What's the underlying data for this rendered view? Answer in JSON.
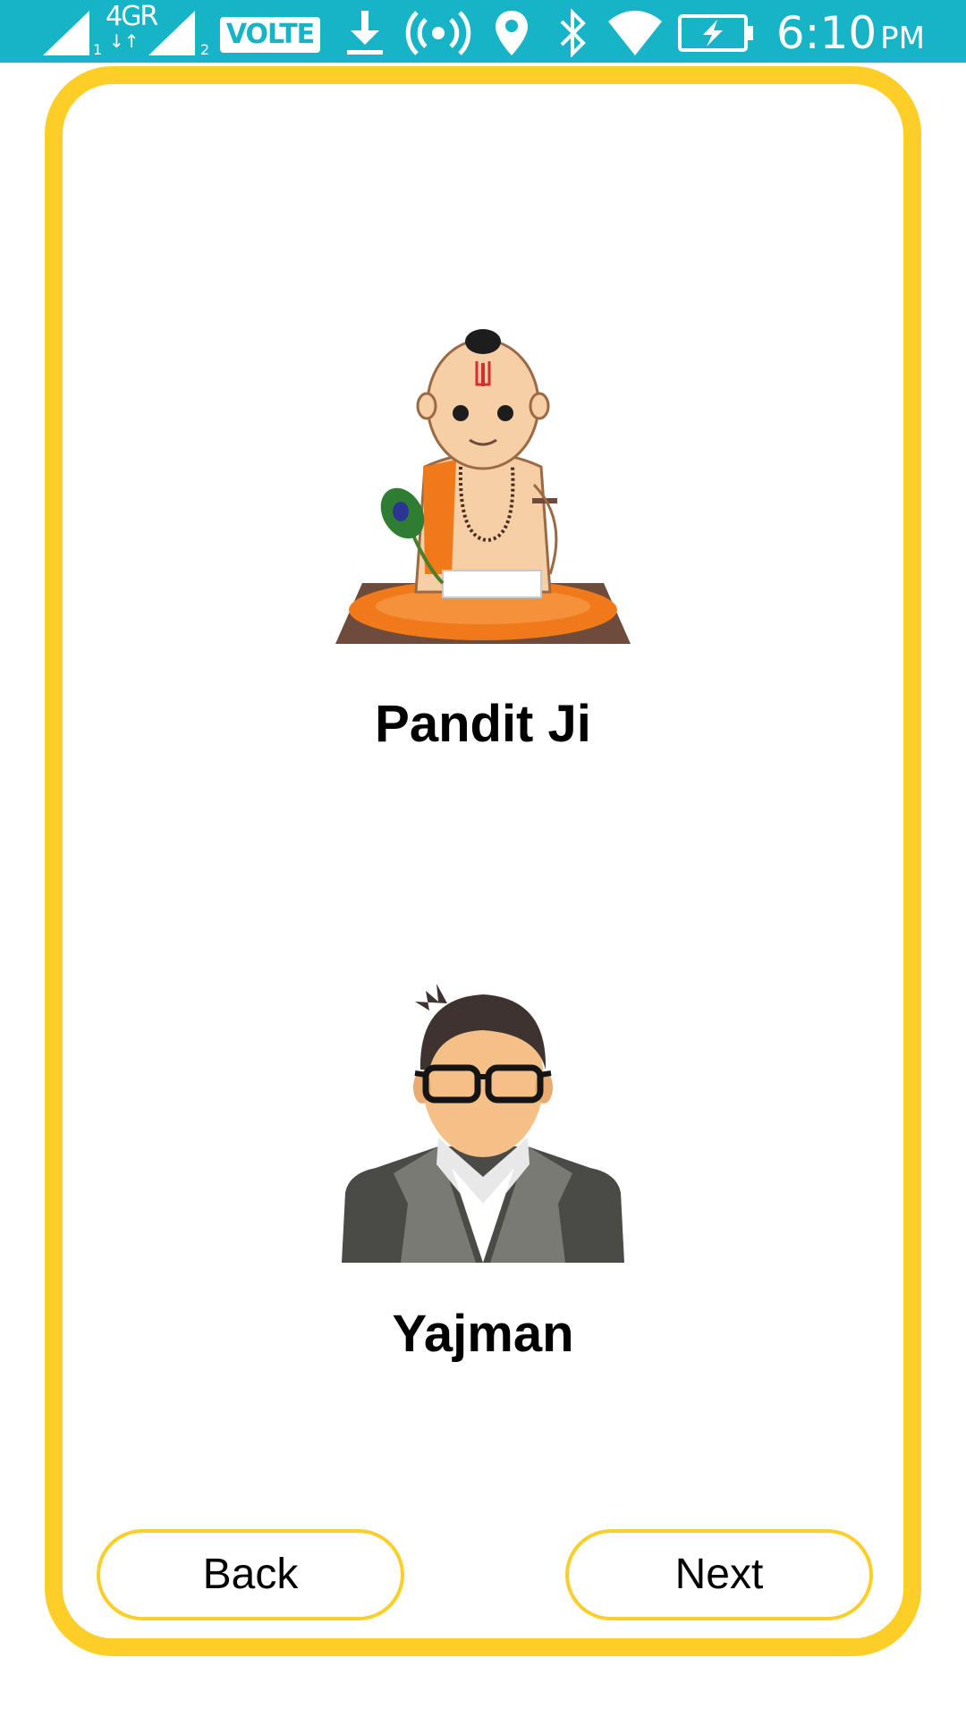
{
  "status_bar": {
    "time": "6:10",
    "ampm": "PM",
    "network_label": "4GR",
    "volte_label": "VOLTE",
    "sim1_index": "1",
    "sim2_index": "2",
    "icons": [
      "signal-icon",
      "signal-icon",
      "volte-icon",
      "download-icon",
      "hotspot-icon",
      "location-icon",
      "bluetooth-icon",
      "wifi-icon",
      "battery-charging-icon"
    ]
  },
  "roles": [
    {
      "label": "Pandit Ji",
      "icon": "pandit-illustration"
    },
    {
      "label": "Yajman",
      "icon": "yajman-illustration"
    }
  ],
  "buttons": {
    "back_label": "Back",
    "next_label": "Next"
  },
  "colors": {
    "status_bar": "#17b3c7",
    "accent": "#fcce27",
    "background": "#ffffff",
    "text": "#000000"
  }
}
